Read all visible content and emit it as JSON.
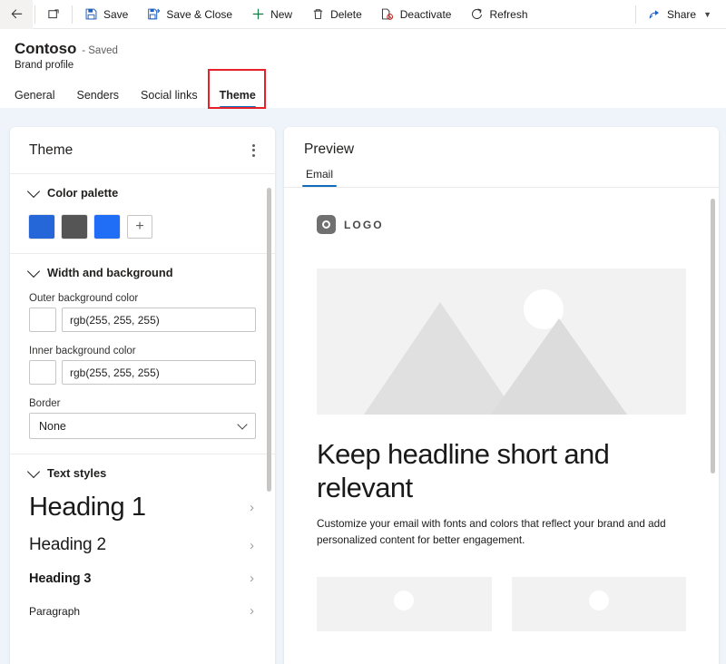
{
  "commandbar": {
    "back_label": "Back",
    "popout_label": "Open in new window",
    "items": [
      {
        "label": "Save",
        "icon": "save-icon"
      },
      {
        "label": "Save & Close",
        "icon": "save-close-icon"
      },
      {
        "label": "New",
        "icon": "plus-icon"
      },
      {
        "label": "Delete",
        "icon": "trash-icon"
      },
      {
        "label": "Deactivate",
        "icon": "deactivate-icon"
      },
      {
        "label": "Refresh",
        "icon": "refresh-icon"
      }
    ],
    "share_label": "Share"
  },
  "header": {
    "record_name": "Contoso",
    "saved_state": "- Saved",
    "entity_type": "Brand profile",
    "tabs": [
      {
        "label": "General",
        "active": false
      },
      {
        "label": "Senders",
        "active": false
      },
      {
        "label": "Social links",
        "active": false
      },
      {
        "label": "Theme",
        "active": true
      }
    ],
    "highlight_color": "#e8202a",
    "active_tab_color": "#0f6cbd"
  },
  "theme_panel": {
    "title": "Theme",
    "more_options": "More options",
    "color_palette": {
      "title": "Color palette",
      "swatches": [
        "#2566d8",
        "#555555",
        "#1f6ef5"
      ],
      "add_label": "+"
    },
    "width_background": {
      "title": "Width and background",
      "outer_label": "Outer background color",
      "outer_value": "rgb(255, 255, 255)",
      "outer_swatch": "#ffffff",
      "inner_label": "Inner background color",
      "inner_value": "rgb(255, 255, 255)",
      "inner_swatch": "#ffffff",
      "border_label": "Border",
      "border_value": "None"
    },
    "text_styles": {
      "title": "Text styles",
      "rows": [
        {
          "label": "Heading 1"
        },
        {
          "label": "Heading 2"
        },
        {
          "label": "Heading 3"
        },
        {
          "label": "Paragraph"
        }
      ]
    }
  },
  "preview_panel": {
    "title": "Preview",
    "tabs": [
      {
        "label": "Email",
        "active": true
      }
    ],
    "email": {
      "logo_text": "LOGO",
      "headline": "Keep headline short and relevant",
      "body": "Customize your email with fonts and colors that reflect your brand and add personalized content for better engagement."
    }
  }
}
